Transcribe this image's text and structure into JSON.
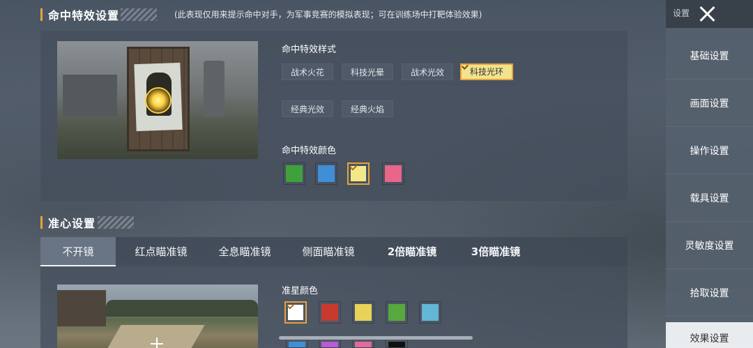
{
  "hit_effect": {
    "title": "命中特效设置",
    "note": "(此表现仅用来提示命中对手，为军事竞赛的模拟表现；可在训练场中打靶体验效果)",
    "style_label": "命中特效样式",
    "styles": [
      "战术火花",
      "科技光晕",
      "战术光效",
      "科技光环",
      "经典光效",
      "经典火焰"
    ],
    "selected_style": "科技光环",
    "color_label": "命中特效颜色",
    "colors": [
      "#3fa13a",
      "#3f8fd6",
      "#f2e88a",
      "#e8668a"
    ],
    "selected_color_index": 2
  },
  "crosshair": {
    "title": "准心设置",
    "tabs": [
      "不开镜",
      "红点瞄准镜",
      "全息瞄准镜",
      "侧面瞄准镜",
      "2倍瞄准镜",
      "3倍瞄准镜"
    ],
    "active_tab": "不开镜",
    "color_label": "准星颜色",
    "colors": [
      "#ffffff",
      "#c83a2e",
      "#e9d25a",
      "#57a83e",
      "#62b6d6"
    ],
    "selected_color_index": 0,
    "colors_row2": [
      "#3f8fd6",
      "#b85bd6",
      "#e06a9a",
      "#111111"
    ]
  },
  "sidebar": {
    "title": "设置",
    "items": [
      "基础设置",
      "画面设置",
      "操作设置",
      "载具设置",
      "灵敏度设置",
      "拾取设置",
      "效果设置"
    ],
    "active_item": "效果设置"
  }
}
